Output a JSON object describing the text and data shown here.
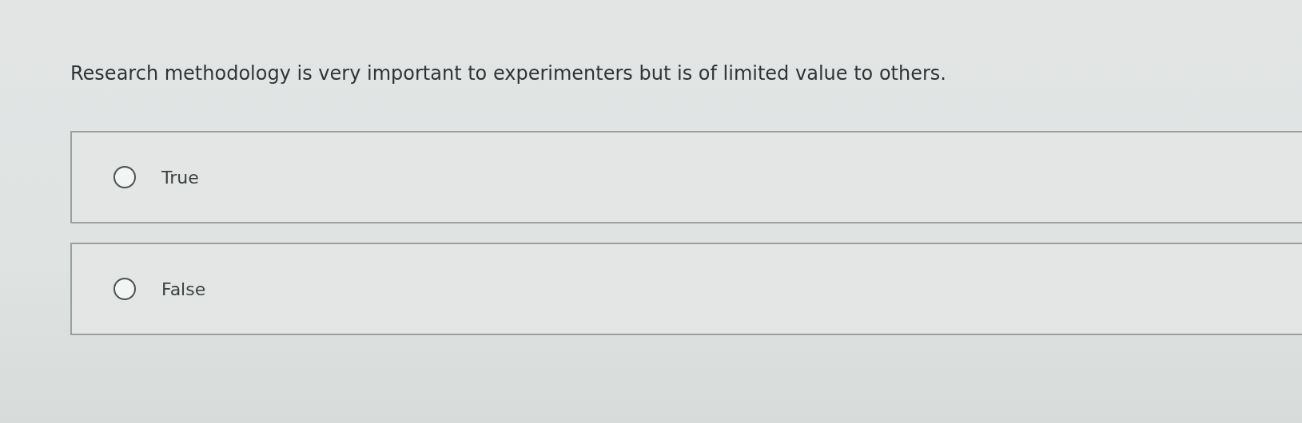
{
  "question": "Research methodology is very important to experimenters but is of limited value to others.",
  "options": [
    {
      "label": "True",
      "selected": false
    },
    {
      "label": "False",
      "selected": false
    }
  ]
}
